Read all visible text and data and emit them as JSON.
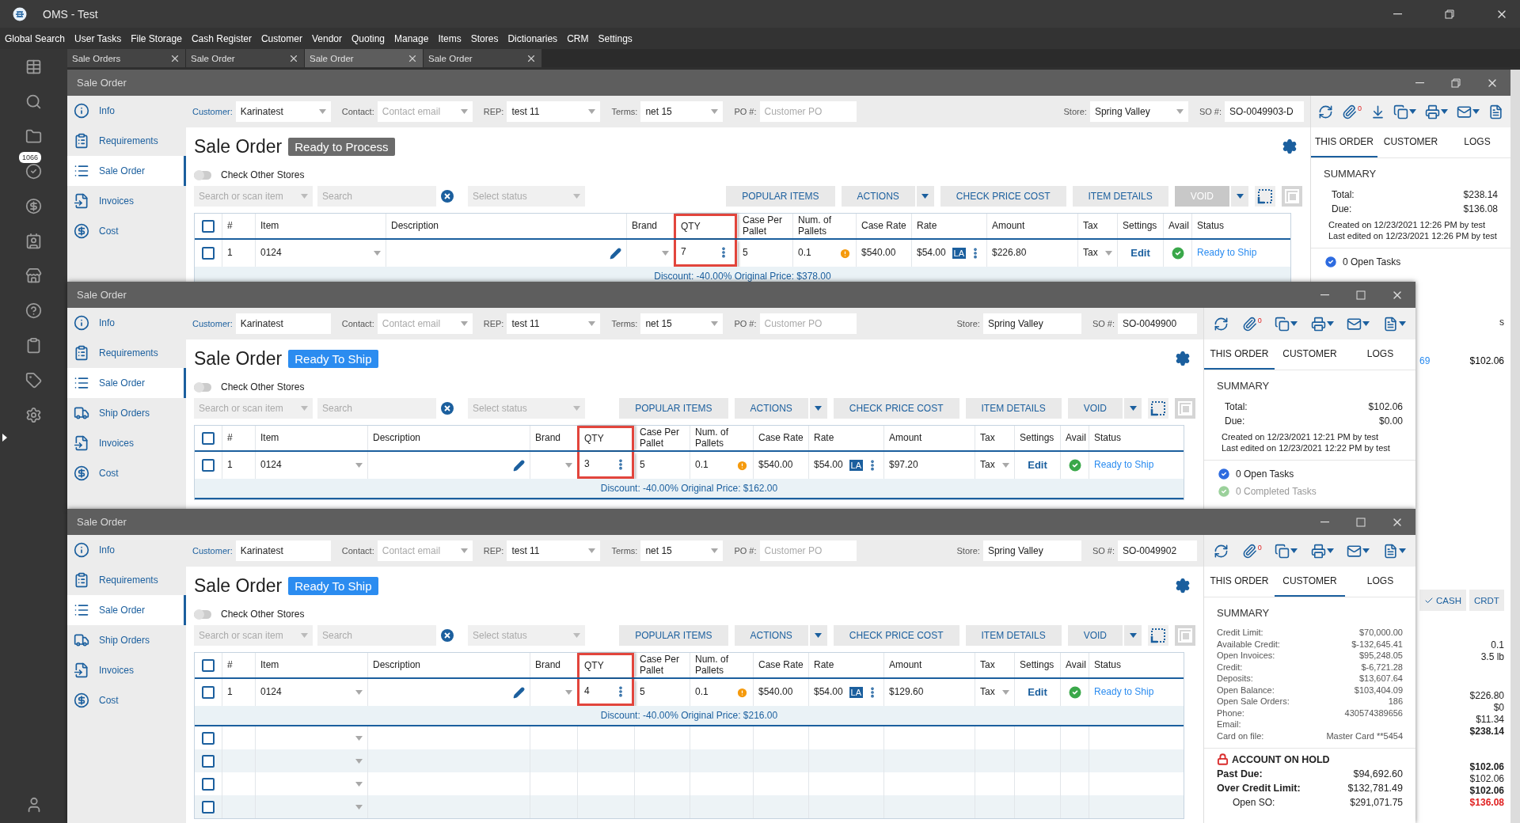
{
  "app": {
    "title": "OMS - Test"
  },
  "menu": [
    "Global Search",
    "User Tasks",
    "File Storage",
    "Cash Register",
    "Customer",
    "Vendor",
    "Quoting",
    "Manage",
    "Items",
    "Stores",
    "Dictionaries",
    "CRM",
    "Settings"
  ],
  "rail_badge": "1066",
  "tabs": [
    {
      "label": "Sale Orders",
      "selected": false
    },
    {
      "label": "Sale Order",
      "selected": false
    },
    {
      "label": "Sale Order",
      "selected": true
    },
    {
      "label": "Sale Order",
      "selected": false
    }
  ],
  "windows": [
    {
      "title": "Sale Order",
      "maximized": true,
      "nav": [
        {
          "kind": "info",
          "label": "Info",
          "selected": false
        },
        {
          "kind": "requirements",
          "label": "Requirements",
          "selected": false
        },
        {
          "kind": "list",
          "label": "Sale Order",
          "selected": true
        },
        {
          "kind": "invoice",
          "label": "Invoices",
          "selected": false
        },
        {
          "kind": "cost",
          "label": "Cost",
          "selected": false
        }
      ],
      "fields": [
        {
          "label": "Customer:",
          "value": "Karinatest",
          "dropdown": true
        },
        {
          "label": "Contact:",
          "placeholder": "Contact email",
          "dropdown": true
        },
        {
          "label": "REP:",
          "value": "test 11",
          "dropdown": true
        },
        {
          "label": "Terms:",
          "value": "net 15",
          "dropdown": true
        },
        {
          "label": "PO #:",
          "placeholder": "Customer PO",
          "dropdown": false
        }
      ],
      "store_fields": [
        {
          "label": "Store:",
          "value": "Spring Valley",
          "dropdown": true
        },
        {
          "label": "SO #:",
          "value": "SO-0049903-D",
          "dropdown": false
        }
      ],
      "toolbar": [
        {
          "kind": "refresh",
          "menu": false
        },
        {
          "kind": "attach",
          "count": "0",
          "menu": false
        },
        {
          "kind": "download",
          "menu": false
        },
        {
          "kind": "copy",
          "menu": true
        },
        {
          "kind": "print",
          "menu": true
        },
        {
          "kind": "mail",
          "menu": true
        },
        {
          "kind": "document",
          "menu": false
        }
      ],
      "heading": "Sale Order",
      "status": {
        "label": "Ready to Process",
        "kind": "processing"
      },
      "toggle": {
        "label": "Check Other Stores",
        "on": false
      },
      "filters": {
        "item_placeholder": "Search or scan item",
        "search_placeholder": "Search",
        "status_placeholder": "Select status"
      },
      "actions": [
        {
          "label": "POPULAR ITEMS",
          "menu": false,
          "disabled": false
        },
        {
          "label": "ACTIONS",
          "menu": true,
          "disabled": false
        },
        {
          "label": "CHECK PRICE COST",
          "menu": false,
          "disabled": false
        },
        {
          "label": "ITEM DETAILS",
          "menu": false,
          "disabled": false
        },
        {
          "label": "VOID",
          "menu": true,
          "disabled": true
        }
      ],
      "table": {
        "header_checked": false,
        "columns": [
          {
            "label": "#",
            "highlighted": false
          },
          {
            "label": "Item",
            "highlighted": false
          },
          {
            "label": "Description",
            "highlighted": false
          },
          {
            "label": "Brand",
            "highlighted": false
          },
          {
            "label": "QTY",
            "highlighted": true
          },
          {
            "label": "Case Per Pallet",
            "highlighted": false
          },
          {
            "label": "Num. of Pallets",
            "highlighted": false
          },
          {
            "label": "Case Rate",
            "highlighted": false
          },
          {
            "label": "Rate",
            "highlighted": false
          },
          {
            "label": "Amount",
            "highlighted": false
          },
          {
            "label": "Tax",
            "highlighted": false
          },
          {
            "label": "Settings",
            "highlighted": false
          },
          {
            "label": "Avail",
            "highlighted": false
          },
          {
            "label": "Status",
            "highlighted": false
          }
        ],
        "rows": [
          {
            "checked": false,
            "number": "1",
            "item": "0124",
            "qty": "7",
            "case_per_pallet": "5",
            "pallets": "0.1",
            "warning": true,
            "case_rate": "$540.00",
            "rate": "$54.00",
            "rate_badge": "LA",
            "amount": "$226.80",
            "tax": "Tax",
            "settings": "Edit",
            "available": true,
            "status": "Ready to Ship"
          }
        ],
        "discount": "Discount: -40.00% Original Price: $378.00"
      },
      "panel": {
        "tabs": [
          {
            "label": "THIS ORDER",
            "selected": true
          },
          {
            "label": "CUSTOMER",
            "selected": false
          },
          {
            "label": "LOGS",
            "selected": false
          }
        ],
        "summary": {
          "kind": "order",
          "title": "SUMMARY",
          "rows": [
            {
              "label": "Total:",
              "value": "$238.14"
            },
            {
              "label": "Due:",
              "value": "$136.08"
            }
          ],
          "notes": [
            "Created on 12/23/2021 12:26 PM by test",
            "Last edited on 12/23/2021 12:26 PM by test"
          ]
        },
        "tasks": [
          {
            "kind": "open",
            "label": "0 Open Tasks"
          }
        ],
        "peek": [
          {
            "kind": "text",
            "items": [
              {
                "text": "s",
                "bold": false,
                "alert": false
              }
            ]
          },
          {
            "kind": "link-row",
            "link": "69",
            "value": "$102.06"
          },
          {
            "kind": "buttons",
            "buttons": [
              {
                "label": "CASH",
                "selected": true
              },
              {
                "label": "CRDT",
                "selected": false
              }
            ]
          },
          {
            "kind": "values",
            "items": [
              {
                "text": "0.1",
                "bold": false,
                "alert": false
              },
              {
                "text": "3.5 lb",
                "bold": false,
                "alert": false
              }
            ]
          },
          {
            "kind": "values",
            "items": [
              {
                "text": "$226.80",
                "bold": false,
                "alert": false
              },
              {
                "text": "$0",
                "bold": false,
                "alert": false
              },
              {
                "text": "$11.34",
                "bold": false,
                "alert": false
              },
              {
                "text": "$238.14",
                "bold": true,
                "alert": false
              }
            ]
          },
          {
            "kind": "values",
            "items": [
              {
                "text": "$102.06",
                "bold": true,
                "alert": false
              },
              {
                "text": "$102.06",
                "bold": false,
                "alert": false
              },
              {
                "text": "$102.06",
                "bold": true,
                "alert": false
              },
              {
                "text": "$136.08",
                "bold": true,
                "alert": true
              }
            ]
          }
        ]
      }
    },
    {
      "title": "Sale Order",
      "maximized": false,
      "nav": [
        {
          "kind": "info",
          "label": "Info",
          "selected": false
        },
        {
          "kind": "requirements",
          "label": "Requirements",
          "selected": false
        },
        {
          "kind": "list",
          "label": "Sale Order",
          "selected": true
        },
        {
          "kind": "ship",
          "label": "Ship Orders",
          "selected": false
        },
        {
          "kind": "invoice",
          "label": "Invoices",
          "selected": false
        },
        {
          "kind": "cost",
          "label": "Cost",
          "selected": false
        }
      ],
      "fields": [
        {
          "label": "Customer:",
          "value": "Karinatest",
          "dropdown": false
        },
        {
          "label": "Contact:",
          "placeholder": "Contact email",
          "dropdown": true
        },
        {
          "label": "REP:",
          "value": "test 11",
          "dropdown": true
        },
        {
          "label": "Terms:",
          "value": "net 15",
          "dropdown": true
        },
        {
          "label": "PO #:",
          "placeholder": "Customer PO",
          "dropdown": false
        }
      ],
      "store_fields": [
        {
          "label": "Store:",
          "value": "Spring Valley",
          "dropdown": false
        },
        {
          "label": "SO #:",
          "value": "SO-0049900",
          "dropdown": false
        }
      ],
      "toolbar": [
        {
          "kind": "refresh",
          "menu": false
        },
        {
          "kind": "attach",
          "count": "0",
          "menu": false
        },
        {
          "kind": "copy",
          "menu": true
        },
        {
          "kind": "print",
          "menu": true
        },
        {
          "kind": "mail",
          "menu": true
        },
        {
          "kind": "document",
          "menu": true
        }
      ],
      "heading": "Sale Order",
      "status": {
        "label": "Ready To Ship",
        "kind": "ready"
      },
      "toggle": {
        "label": "Check Other Stores",
        "on": false
      },
      "filters": {
        "item_placeholder": "Search or scan item",
        "search_placeholder": "Search",
        "status_placeholder": "Select status"
      },
      "actions": [
        {
          "label": "POPULAR ITEMS",
          "menu": false,
          "disabled": false
        },
        {
          "label": "ACTIONS",
          "menu": true,
          "disabled": false
        },
        {
          "label": "CHECK PRICE COST",
          "menu": false,
          "disabled": false
        },
        {
          "label": "ITEM DETAILS",
          "menu": false,
          "disabled": false
        },
        {
          "label": "VOID",
          "menu": true,
          "disabled": false
        }
      ],
      "table": {
        "header_checked": false,
        "columns": [
          {
            "label": "#",
            "highlighted": false
          },
          {
            "label": "Item",
            "highlighted": false
          },
          {
            "label": "Description",
            "highlighted": false
          },
          {
            "label": "Brand",
            "highlighted": false
          },
          {
            "label": "QTY",
            "highlighted": true
          },
          {
            "label": "Case Per Pallet",
            "highlighted": false
          },
          {
            "label": "Num. of Pallets",
            "highlighted": false
          },
          {
            "label": "Case Rate",
            "highlighted": false
          },
          {
            "label": "Rate",
            "highlighted": false
          },
          {
            "label": "Amount",
            "highlighted": false
          },
          {
            "label": "Tax",
            "highlighted": false
          },
          {
            "label": "Settings",
            "highlighted": false
          },
          {
            "label": "Avail",
            "highlighted": false
          },
          {
            "label": "Status",
            "highlighted": false
          }
        ],
        "rows": [
          {
            "checked": false,
            "number": "1",
            "item": "0124",
            "qty": "3",
            "case_per_pallet": "5",
            "pallets": "0.1",
            "warning": true,
            "case_rate": "$540.00",
            "rate": "$54.00",
            "rate_badge": "LA",
            "amount": "$97.20",
            "tax": "Tax",
            "settings": "Edit",
            "available": true,
            "status": "Ready to Ship"
          }
        ],
        "discount": "Discount: -40.00% Original Price: $162.00"
      },
      "panel": {
        "tabs": [
          {
            "label": "THIS ORDER",
            "selected": true
          },
          {
            "label": "CUSTOMER",
            "selected": false
          },
          {
            "label": "LOGS",
            "selected": false
          }
        ],
        "summary": {
          "kind": "order",
          "title": "SUMMARY",
          "rows": [
            {
              "label": "Total:",
              "value": "$102.06"
            },
            {
              "label": "Due:",
              "value": "$0.00"
            }
          ],
          "notes": [
            "Created on 12/23/2021 12:21 PM by test",
            "Last edited on 12/23/2021 12:22 PM by test"
          ]
        },
        "tasks": [
          {
            "kind": "open",
            "label": "0 Open Tasks"
          },
          {
            "kind": "completed",
            "label": "0 Completed Tasks"
          }
        ]
      }
    },
    {
      "title": "Sale Order",
      "maximized": false,
      "nav": [
        {
          "kind": "info",
          "label": "Info",
          "selected": false
        },
        {
          "kind": "requirements",
          "label": "Requirements",
          "selected": false
        },
        {
          "kind": "list",
          "label": "Sale Order",
          "selected": true
        },
        {
          "kind": "ship",
          "label": "Ship Orders",
          "selected": false
        },
        {
          "kind": "invoice",
          "label": "Invoices",
          "selected": false
        },
        {
          "kind": "cost",
          "label": "Cost",
          "selected": false
        }
      ],
      "fields": [
        {
          "label": "Customer:",
          "value": "Karinatest",
          "dropdown": false
        },
        {
          "label": "Contact:",
          "placeholder": "Contact email",
          "dropdown": true
        },
        {
          "label": "REP:",
          "value": "test 11",
          "dropdown": true
        },
        {
          "label": "Terms:",
          "value": "net 15",
          "dropdown": true
        },
        {
          "label": "PO #:",
          "placeholder": "Customer PO",
          "dropdown": false
        }
      ],
      "store_fields": [
        {
          "label": "Store:",
          "value": "Spring Valley",
          "dropdown": false
        },
        {
          "label": "SO #:",
          "value": "SO-0049902",
          "dropdown": false
        }
      ],
      "toolbar": [
        {
          "kind": "refresh",
          "menu": false
        },
        {
          "kind": "attach",
          "count": "0",
          "menu": false
        },
        {
          "kind": "copy",
          "menu": true
        },
        {
          "kind": "print",
          "menu": true
        },
        {
          "kind": "mail",
          "menu": true
        },
        {
          "kind": "document",
          "menu": true
        }
      ],
      "heading": "Sale Order",
      "status": {
        "label": "Ready To Ship",
        "kind": "ready"
      },
      "toggle": {
        "label": "Check Other Stores",
        "on": false
      },
      "filters": {
        "item_placeholder": "Search or scan item",
        "search_placeholder": "Search",
        "status_placeholder": "Select status"
      },
      "actions": [
        {
          "label": "POPULAR ITEMS",
          "menu": false,
          "disabled": false
        },
        {
          "label": "ACTIONS",
          "menu": true,
          "disabled": false
        },
        {
          "label": "CHECK PRICE COST",
          "menu": false,
          "disabled": false
        },
        {
          "label": "ITEM DETAILS",
          "menu": false,
          "disabled": false
        },
        {
          "label": "VOID",
          "menu": true,
          "disabled": false
        }
      ],
      "table": {
        "header_checked": false,
        "columns": [
          {
            "label": "#",
            "highlighted": false
          },
          {
            "label": "Item",
            "highlighted": false
          },
          {
            "label": "Description",
            "highlighted": false
          },
          {
            "label": "Brand",
            "highlighted": false
          },
          {
            "label": "QTY",
            "highlighted": true
          },
          {
            "label": "Case Per Pallet",
            "highlighted": false
          },
          {
            "label": "Num. of Pallets",
            "highlighted": false
          },
          {
            "label": "Case Rate",
            "highlighted": false
          },
          {
            "label": "Rate",
            "highlighted": false
          },
          {
            "label": "Amount",
            "highlighted": false
          },
          {
            "label": "Tax",
            "highlighted": false
          },
          {
            "label": "Settings",
            "highlighted": false
          },
          {
            "label": "Avail",
            "highlighted": false
          },
          {
            "label": "Status",
            "highlighted": false
          }
        ],
        "rows": [
          {
            "checked": false,
            "number": "1",
            "item": "0124",
            "qty": "4",
            "case_per_pallet": "5",
            "pallets": "0.1",
            "warning": true,
            "case_rate": "$540.00",
            "rate": "$54.00",
            "rate_badge": "LA",
            "amount": "$129.60",
            "tax": "Tax",
            "settings": "Edit",
            "available": true,
            "status": "Ready to Ship"
          }
        ],
        "discount": "Discount: -40.00% Original Price: $216.00",
        "empty_rows": [
          {
            "checked": false
          },
          {
            "checked": false
          },
          {
            "checked": false
          },
          {
            "checked": false
          }
        ]
      },
      "panel": {
        "tabs": [
          {
            "label": "THIS ORDER",
            "selected": false
          },
          {
            "label": "CUSTOMER",
            "selected": true
          },
          {
            "label": "LOGS",
            "selected": false
          }
        ],
        "summary": {
          "kind": "customer",
          "title": "SUMMARY",
          "rows": [
            {
              "label": "Credit Limit:",
              "value": "$70,000.00"
            },
            {
              "label": "Available Credit:",
              "value": "$-132,645.41"
            },
            {
              "label": "Open Invoices:",
              "value": "$95,248.05"
            },
            {
              "label": "Credit:",
              "value": "$-6,721.28"
            },
            {
              "label": "Deposits:",
              "value": "$13,607.64"
            },
            {
              "label": "Open Balance:",
              "value": "$103,404.09"
            },
            {
              "label": "Open Sale Orders:",
              "value": "186"
            },
            {
              "label": "Phone:",
              "value": "430574389656"
            },
            {
              "label": "Email:"
            },
            {
              "label": "Card on file:",
              "value": "Master Card **5454"
            }
          ]
        },
        "hold": {
          "title": "ACCOUNT ON HOLD",
          "rows": [
            {
              "label": "Past Due:",
              "value": "$94,692.60"
            },
            {
              "label": "Over Credit Limit:",
              "value": "$132,781.49",
              "children": [
                {
                  "label": "Open SO:",
                  "value": "$291,071.75"
                }
              ]
            }
          ]
        }
      }
    }
  ]
}
